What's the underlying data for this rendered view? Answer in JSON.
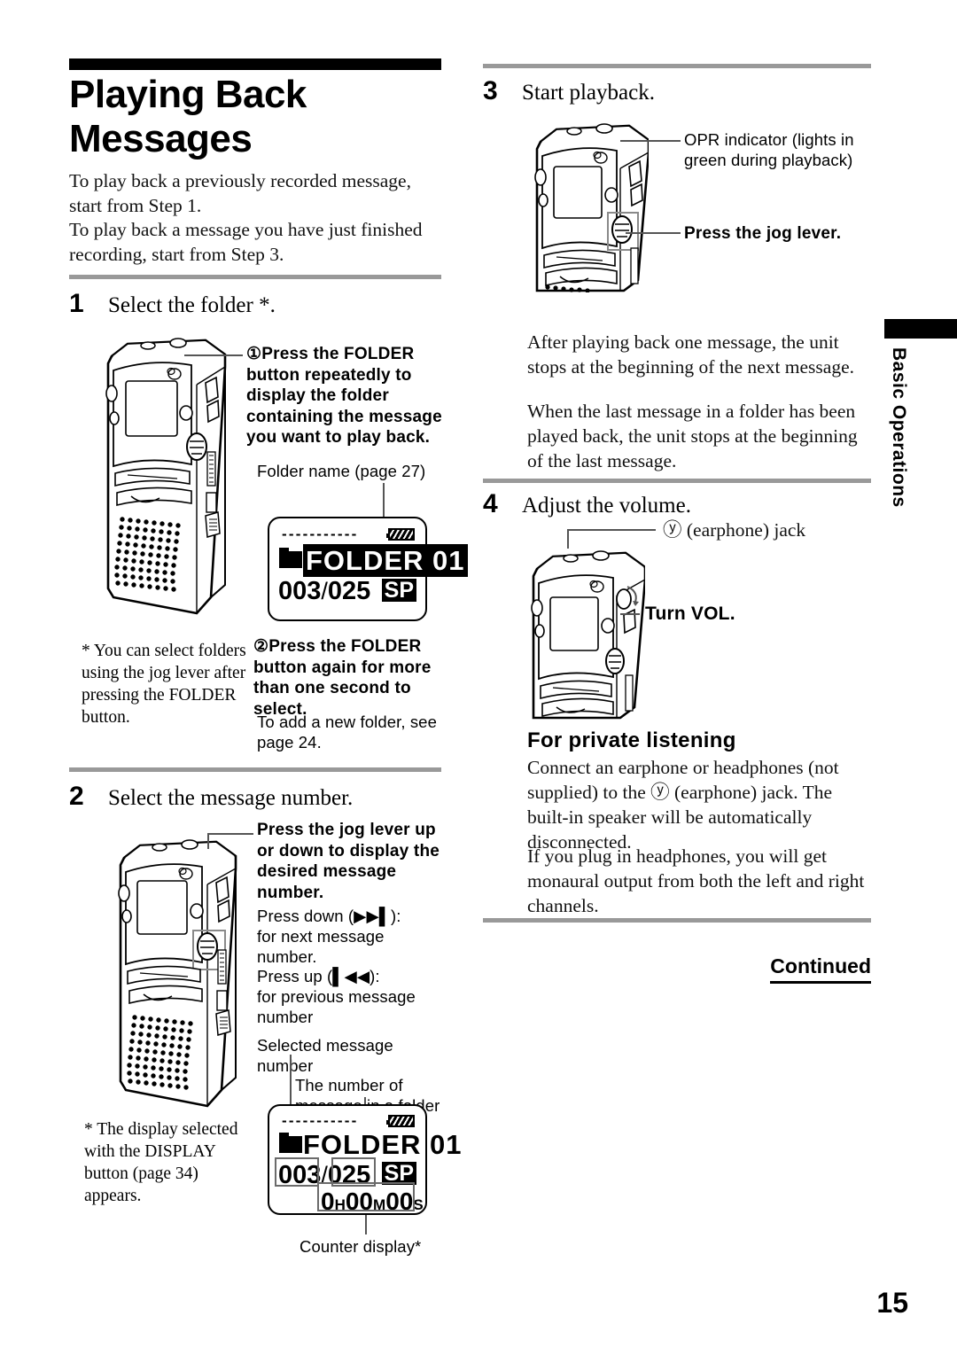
{
  "page": {
    "title_line1": "Playing Back",
    "title_line2": "Messages",
    "number": "15",
    "side_tab": "Basic Operations",
    "continued": "Continued"
  },
  "intro": {
    "para1": "To play back a previously recorded message, start from Step 1.",
    "para2": "To play back a message you have just finished recording, start from Step 3."
  },
  "steps": {
    "step1": {
      "num": "1",
      "text": "Select the folder *.",
      "callout1_bold": "①Press the FOLDER button repeatedly to display the folder containing the message you want to play back.",
      "callout1_label": "Folder name (page 27)",
      "callout2_bold": "②Press the FOLDER button again for more than one second to select.",
      "callout2_plain": "To add a new folder, see page 24.",
      "footnote": "* You can select folders using the jog lever after pressing the FOLDER button.",
      "lcd": {
        "dashes": "-----------",
        "folder_name": "FOLDER 01",
        "selected": "003",
        "slash": "/",
        "total": "025",
        "mode": "SP"
      }
    },
    "step2": {
      "num": "2",
      "text": "Select the message number.",
      "callout_bold": "Press the jog lever up or down to display the desired message number.",
      "callout_plain_1": "Press down (▶▶▌):",
      "callout_plain_2": "for next message number.",
      "callout_plain_3": "Press up (▌◀◀):",
      "callout_plain_4": "for previous message number",
      "label_selected": "Selected message number",
      "label_total": "The number of message in a folder",
      "label_counter": "Counter display*",
      "footnote": "* The display selected with the DISPLAY button (page 34) appears.",
      "lcd": {
        "dashes": "-----------",
        "folder_name": "FOLDER 01",
        "selected": "003",
        "slash": "/",
        "total": "025",
        "mode": "SP",
        "time_h": "0",
        "time_h_unit": "H",
        "time_m": "00",
        "time_m_unit": "M",
        "time_s": "00",
        "time_s_unit": "S"
      }
    },
    "step3": {
      "num": "3",
      "text": "Start playback.",
      "label_opr": "OPR indicator (lights in green during playback)",
      "label_jog": "Press the jog lever.",
      "para1": "After playing back one message, the unit stops at the beginning of the next message.",
      "para2": "When the last message in a folder has been played back, the unit stops at the beginning of the last message."
    },
    "step4": {
      "num": "4",
      "text": "Adjust the volume.",
      "label_jack": "ⓨ (earphone) jack",
      "label_vol": "Turn VOL."
    }
  },
  "private_listening": {
    "heading": "For private listening",
    "para1": "Connect an earphone or headphones (not supplied) to the ⓨ (earphone) jack. The built-in speaker will be automatically disconnected.",
    "para2": "If you plug in headphones, you will get monaural output from both the left and right channels."
  }
}
